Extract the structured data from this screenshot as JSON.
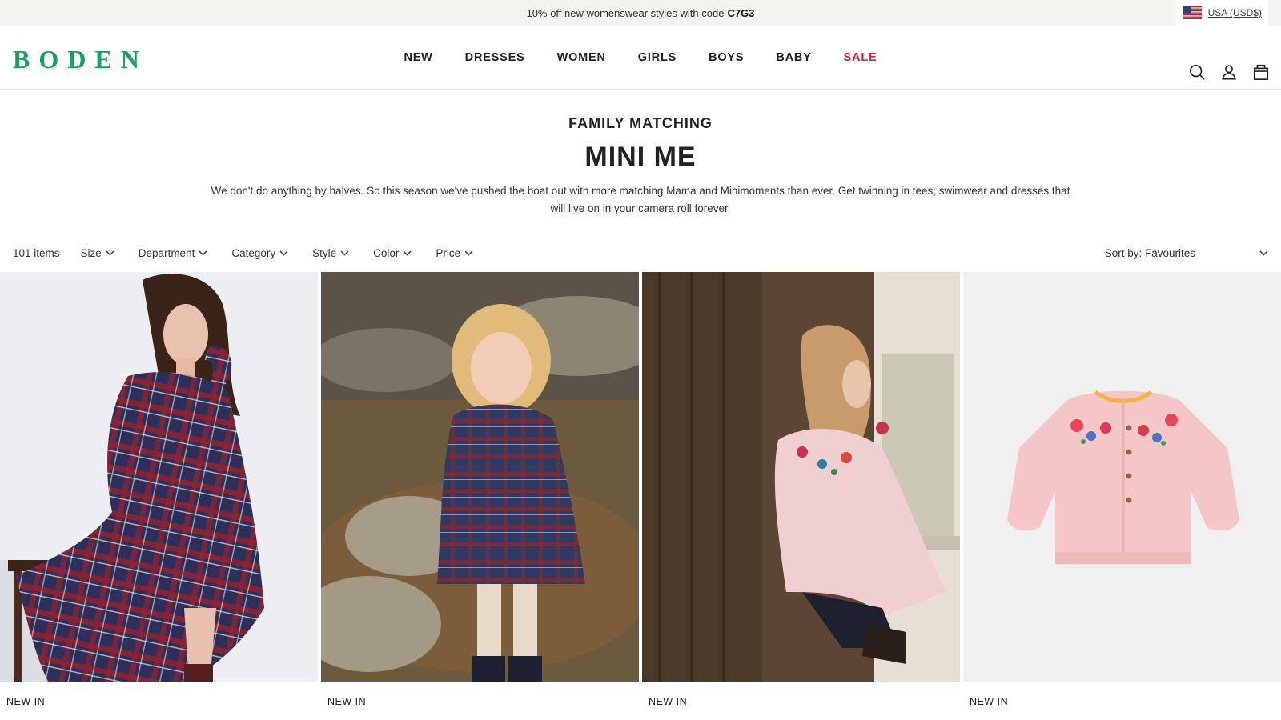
{
  "promo": {
    "text": "10% off new womenswear styles with code",
    "code": "C7G3"
  },
  "locale": {
    "label": "USA (USD$)",
    "flag_icon": "us-flag-icon"
  },
  "brand": {
    "logo": "BODEN",
    "color": "#16a163"
  },
  "nav": {
    "items": [
      "NEW",
      "DRESSES",
      "WOMEN",
      "GIRLS",
      "BOYS",
      "BABY",
      "SALE"
    ],
    "sale_color": "#d0262d"
  },
  "header_icons": [
    "search-icon",
    "account-icon",
    "bag-icon"
  ],
  "page": {
    "eyebrow": "FAMILY MATCHING",
    "title": "MINI ME",
    "description": "We don't do anything by halves. So this season we've pushed the boat out with more matching Mama and Minimoments than ever. Get twinning in tees, swimwear and dresses that will live on in your camera roll forever."
  },
  "filters": {
    "count": "101 items",
    "items": [
      "Size",
      "Department",
      "Category",
      "Style",
      "Color",
      "Price"
    ],
    "sort": "Sort by: Favourites"
  },
  "products": [
    {
      "badge": "NEW IN",
      "image": "woman-tartan-maxi-dress-photo"
    },
    {
      "badge": "NEW IN",
      "image": "girl-tartan-dress-photo"
    },
    {
      "badge": "NEW IN",
      "image": "woman-embroidered-cardigan-photo"
    },
    {
      "badge": "NEW IN",
      "image": "pink-embroidered-cardigan-photo"
    }
  ]
}
